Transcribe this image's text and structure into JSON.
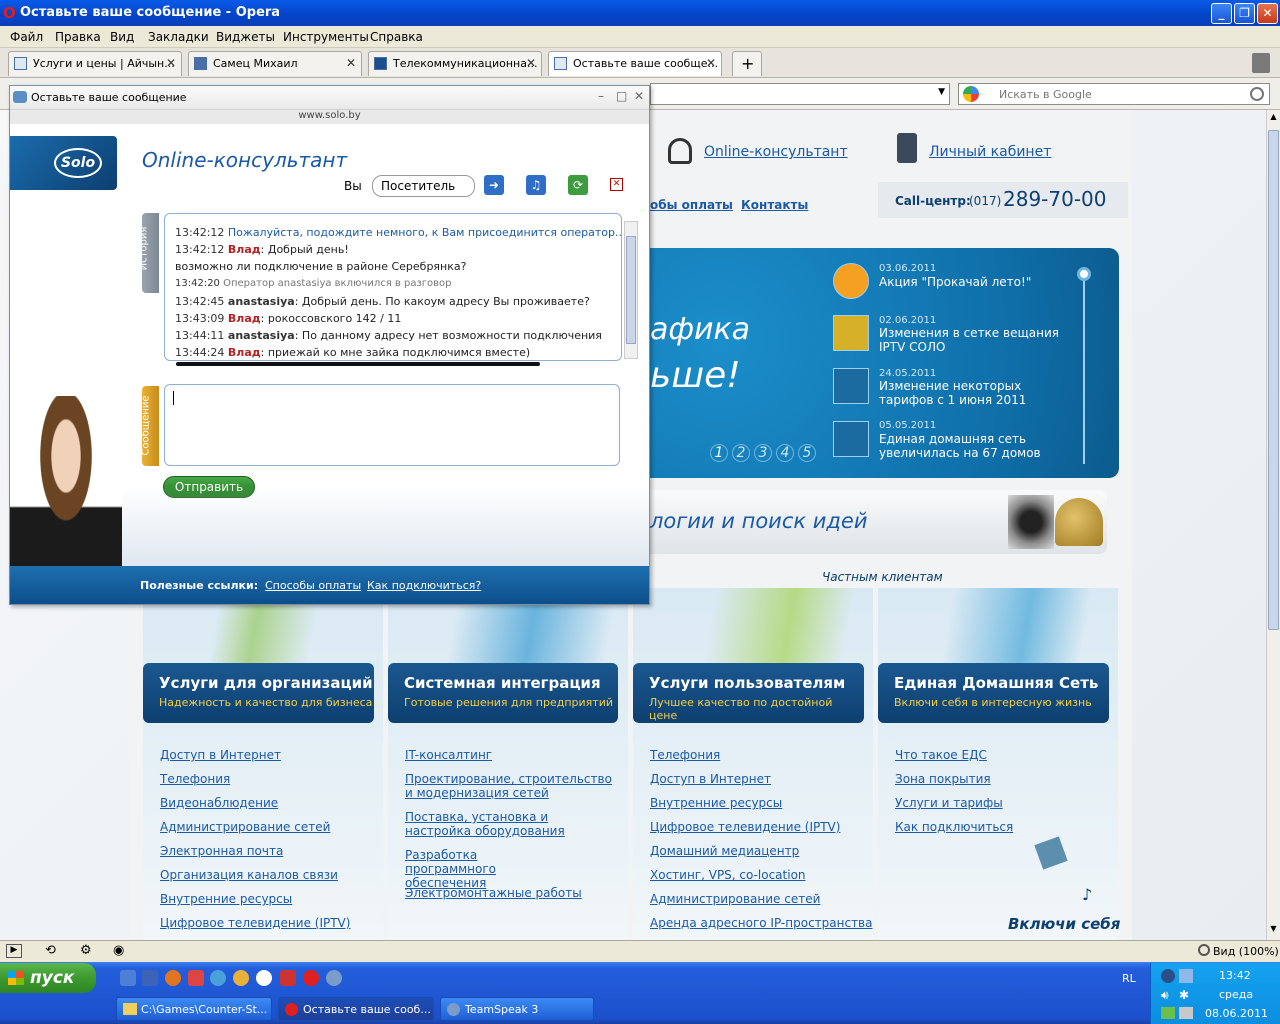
{
  "window": {
    "title": "Оставьте ваше сообщение - Opera",
    "minimize": "_",
    "maximize": "❐",
    "close": "✕"
  },
  "menu": [
    "Файл",
    "Правка",
    "Вид",
    "Закладки",
    "Виджеты",
    "Инструменты",
    "Справка"
  ],
  "tabs": [
    {
      "label": "Услуги и цены | Айчын..."
    },
    {
      "label": "Самец Михаил"
    },
    {
      "label": "Телекоммуникационна..."
    },
    {
      "label": "Оставьте ваше сообще..."
    }
  ],
  "tab_add": "+",
  "search": {
    "placeholder": "Искать в Google"
  },
  "site": {
    "header_links": [
      "Online-консультант",
      "Личный кабинет"
    ],
    "nav_links": [
      "обы оплаты",
      "Контакты"
    ],
    "callcenter_label": "Call-центр:",
    "callcenter_code": "(017)",
    "callcenter_number": "289-70-00",
    "banner_line1": "афика",
    "banner_line2": "ьше!",
    "banner_pages": [
      "1",
      "2",
      "3",
      "4",
      "5"
    ],
    "news": [
      {
        "date": "03.06.2011",
        "text": "Акция \"Прокачай лето!\""
      },
      {
        "date": "02.06.2011",
        "text": "Изменения в сетке вещания IPTV СОЛО"
      },
      {
        "date": "24.05.2011",
        "text": "Изменение некоторых тарифов с 1 июня 2011"
      },
      {
        "date": "05.05.2011",
        "text": "Единая домашняя сеть увеличилась на 67 домов"
      }
    ],
    "strip_text": "логии и поиск идей",
    "private_clients": "Частным клиентам",
    "columns": [
      {
        "title": "Услуги для организаций",
        "subtitle": "Надежность и качество для бизнеса",
        "links": [
          "Доступ в Интернет",
          "Телефония",
          "Видеонаблюдение",
          "Администрирование сетей",
          "Электронная почта",
          "Организация каналов связи",
          "Внутренние ресурсы",
          "Цифровое телевидение (IPTV)"
        ]
      },
      {
        "title": "Системная интеграция",
        "subtitle": "Готовые решения для предприятий",
        "links": [
          "IT-консалтинг",
          "Проектирование, строительство и модернизация сетей",
          "Поставка, установка и настройка оборудования",
          "Разработка программного обеспечения",
          "Электромонтажные работы"
        ]
      },
      {
        "title": "Услуги пользователям",
        "subtitle": "Лучшее качество по достойной цене",
        "links": [
          "Телефония",
          "Доступ в Интернет",
          "Внутренние ресурсы",
          "Цифровое телевидение (IPTV)",
          "Домашний медиацентр",
          "Хостинг, VPS, co-location",
          "Администрирование сетей",
          "Аренда адресного IP-пространства"
        ]
      },
      {
        "title": "Единая Домашняя Сеть",
        "subtitle": "Включи себя в интересную жизнь",
        "links": [
          "Что такое ЕДС",
          "Зона покрытия",
          "Услуги и тарифы",
          "Как подключиться"
        ]
      }
    ],
    "edc_slogan": "Включи себя"
  },
  "popup": {
    "title": "Оставьте ваше сообщение",
    "url": "www.solo.by",
    "logo": "Solo",
    "heading": "Online-консультант",
    "you_label": "Вы",
    "visitor_value": "Посетитель",
    "history_tab": "История",
    "message_tab": "Сообщение",
    "send": "Отправить",
    "chat": [
      {
        "time": "13:42:12",
        "author": "",
        "text": "Пожалуйста, подождите немного, к Вам присоединится оператор..",
        "kind": "sys1"
      },
      {
        "time": "13:42:12",
        "author": "Влад",
        "text": ": Добрый день!",
        "kind": "vlad"
      },
      {
        "time": "",
        "author": "",
        "text": "возможно ли подключение в районе Серебрянка?",
        "kind": "plain"
      },
      {
        "time": "13:42:20",
        "author": "",
        "text": "Оператор anastasiya включился в разговор",
        "kind": "sys2"
      },
      {
        "time": "13:42:45",
        "author": "anastasiya",
        "text": ": Добрый день. По какоум адресу Вы проживаете?",
        "kind": "op"
      },
      {
        "time": "13:43:09",
        "author": "Влад",
        "text": ": рокоссовского 142 / 11",
        "kind": "vlad"
      },
      {
        "time": "13:44:11",
        "author": "anastasiya",
        "text": ": По данному адресу нет возможности подключения",
        "kind": "op"
      },
      {
        "time": "13:44:24",
        "author": "Влад",
        "text": ": приежай ко мне зайка подключимся вместе)",
        "kind": "vlad"
      }
    ],
    "footer_label": "Полезные ссылки:",
    "footer_links": [
      "Способы оплаты",
      "Как подключиться?"
    ]
  },
  "statusbar": {
    "zoom": "Вид (100%)"
  },
  "taskbar": {
    "start": "пуск",
    "tasks": [
      "C:\\Games\\Counter-St...",
      "Оставьте ваше сооб...",
      "TeamSpeak 3"
    ],
    "lang": "RL",
    "time": "13:42",
    "day": "среда",
    "date": "08.06.2011"
  }
}
